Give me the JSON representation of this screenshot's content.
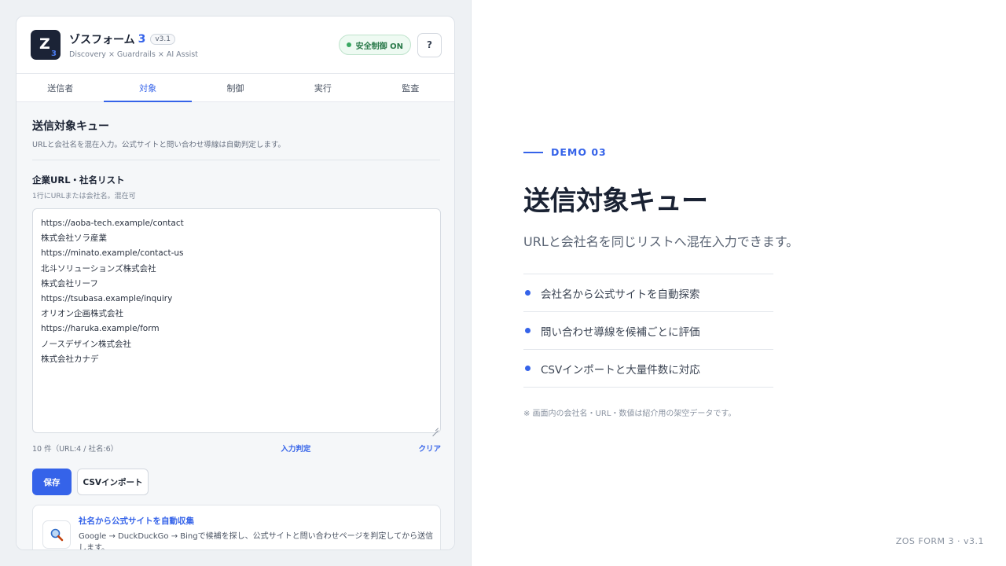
{
  "app": {
    "logo_letter": "Z",
    "logo_number": "3",
    "name": "ゾスフォーム",
    "name_number": "3",
    "version": "v3.1",
    "subtitle": "Discovery × Guardrails × AI Assist",
    "safety_label": "安全制御 ON",
    "help_label": "?"
  },
  "tabs": [
    {
      "label": "送信者"
    },
    {
      "label": "対象",
      "active": true
    },
    {
      "label": "制御"
    },
    {
      "label": "実行"
    },
    {
      "label": "監査"
    }
  ],
  "section": {
    "title": "送信対象キュー",
    "description": "URLと会社名を混在入力。公式サイトと問い合わせ導線は自動判定します。"
  },
  "field": {
    "label": "企業URL・社名リスト",
    "hint": "1行にURLまたは会社名。混在可",
    "lines": [
      "https://aoba-tech.example/contact",
      "株式会社ソラ産業",
      "https://minato.example/contact-us",
      "北斗ソリューションズ株式会社",
      "株式会社リーフ",
      "https://tsubasa.example/inquiry",
      "オリオン企画株式会社",
      "https://haruka.example/form",
      "ノースデザイン株式会社",
      "株式会社カナデ"
    ]
  },
  "meta": {
    "count": "10 件（URL:4 / 社名:6）",
    "judge": "入力判定",
    "clear": "クリア"
  },
  "buttons": {
    "save": "保存",
    "csv_import": "CSVインポート"
  },
  "info": {
    "icon": "magnifier-icon",
    "title": "社名から公式サイトを自動収集",
    "description": "Google → DuckDuckGo → Bingで候補を探し、公式サイトと問い合わせページを判定してから送信します。"
  },
  "showcase": {
    "tag": "DEMO 03",
    "title": "送信対象キュー",
    "subtitle": "URLと会社名を同じリストへ混在入力できます。",
    "features": [
      "会社名から公式サイトを自動探索",
      "問い合わせ導線を候補ごとに評価",
      "CSVインポートと大量件数に対応"
    ],
    "note": "※ 画面内の会社名・URL・数値は紹介用の架空データです。",
    "footer": "ZOS FORM 3 · v3.1"
  },
  "colors": {
    "accent": "#3563e9",
    "dark": "#1b2336",
    "safety_green": "#3aa862"
  }
}
